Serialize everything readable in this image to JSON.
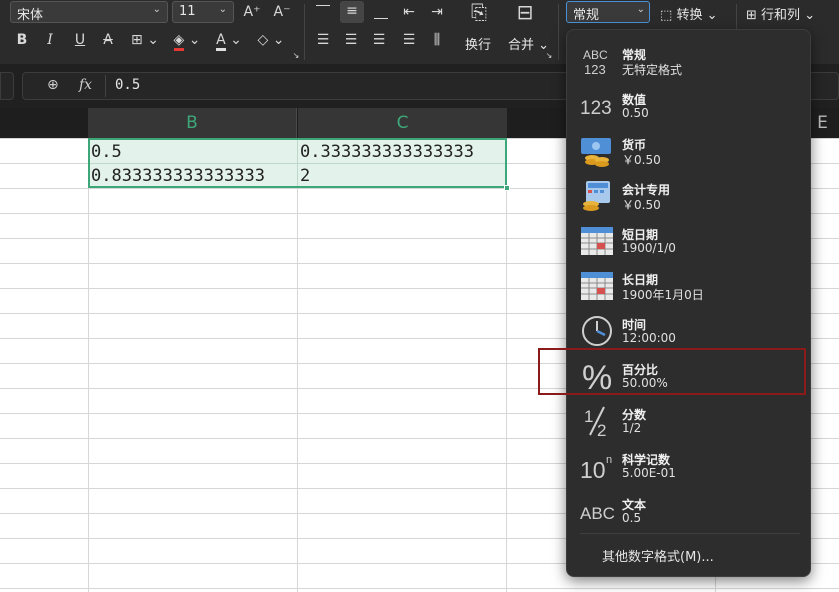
{
  "ribbon": {
    "font_name": "宋体",
    "font_size": "11",
    "grow_font": "A⁺",
    "shrink_font": "A⁻",
    "bold": "B",
    "italic": "I",
    "underline": "U",
    "strike": "A",
    "wrap_label": "换行",
    "merge_label": "合并",
    "number_format": "常规",
    "convert_label": "转换",
    "rows_cols_label": "行和列"
  },
  "formula_bar": {
    "fx": "fx",
    "value": "0.5"
  },
  "columns": [
    {
      "name": "B"
    },
    {
      "name": "C"
    },
    {
      "name": "E"
    }
  ],
  "cells": {
    "B1": "0.5",
    "C1": "0.333333333333333",
    "B2": "0.833333333333333",
    "C2": "2"
  },
  "format_menu": {
    "items": [
      {
        "label": "常规",
        "sample": "无特定格式",
        "icon": "abc-123-icon"
      },
      {
        "label": "数值",
        "sample": "0.50",
        "icon": "number-123-icon"
      },
      {
        "label": "货币",
        "sample": "￥0.50",
        "icon": "currency-icon"
      },
      {
        "label": "会计专用",
        "sample": "￥0.50",
        "icon": "accounting-icon"
      },
      {
        "label": "短日期",
        "sample": "1900/1/0",
        "icon": "short-date-icon"
      },
      {
        "label": "长日期",
        "sample": "1900年1月0日",
        "icon": "long-date-icon"
      },
      {
        "label": "时间",
        "sample": "12:00:00",
        "icon": "clock-icon"
      },
      {
        "label": "百分比",
        "sample": "50.00%",
        "icon": "percent-icon"
      },
      {
        "label": "分数",
        "sample": "1/2",
        "icon": "fraction-icon"
      },
      {
        "label": "科学记数",
        "sample": "5.00E-01",
        "icon": "scientific-icon"
      },
      {
        "label": "文本",
        "sample": "0.5",
        "icon": "text-abc-icon"
      }
    ],
    "more": "其他数字格式(M)..."
  },
  "colors": {
    "selection_border": "#3ea77a",
    "selection_fill": "#e3f2ea",
    "highlight_box": "#8b1a1a"
  }
}
